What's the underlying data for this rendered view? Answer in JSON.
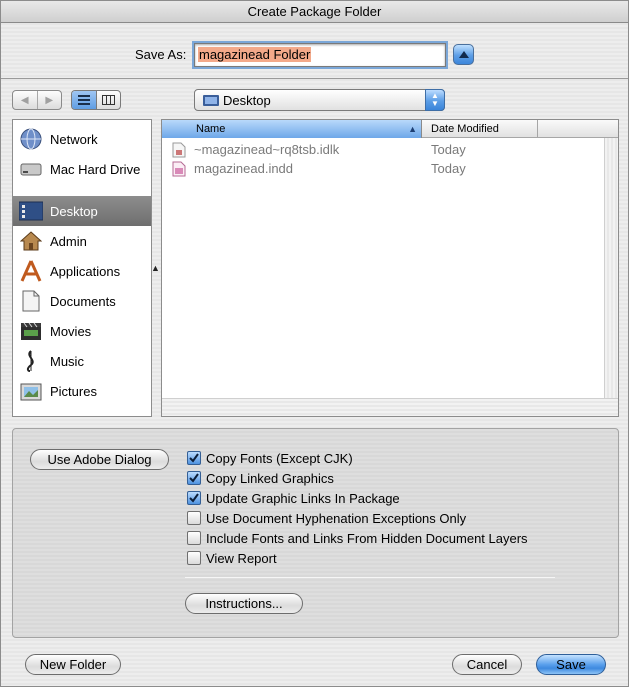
{
  "window": {
    "title": "Create Package Folder"
  },
  "save_as": {
    "label": "Save As:",
    "value": "magazinead Folder"
  },
  "location": {
    "current": "Desktop"
  },
  "sidebar": {
    "items": [
      {
        "label": "Network",
        "icon": "network-globe-icon"
      },
      {
        "label": "Mac Hard Drive",
        "icon": "hard-drive-icon"
      },
      {
        "label": "Desktop",
        "icon": "desktop-icon",
        "selected": true
      },
      {
        "label": "Admin",
        "icon": "home-icon"
      },
      {
        "label": "Applications",
        "icon": "applications-icon"
      },
      {
        "label": "Documents",
        "icon": "documents-icon"
      },
      {
        "label": "Movies",
        "icon": "movies-icon"
      },
      {
        "label": "Music",
        "icon": "music-icon"
      },
      {
        "label": "Pictures",
        "icon": "pictures-icon"
      }
    ]
  },
  "file_list": {
    "columns": {
      "name": "Name",
      "date": "Date Modified"
    },
    "rows": [
      {
        "name": "~magazinead~rq8tsb.idlk",
        "date": "Today"
      },
      {
        "name": "magazinead.indd",
        "date": "Today"
      }
    ]
  },
  "options": {
    "use_adobe_dialog": "Use Adobe Dialog",
    "checkboxes": [
      {
        "label": "Copy Fonts (Except CJK)",
        "checked": true
      },
      {
        "label": "Copy Linked Graphics",
        "checked": true
      },
      {
        "label": "Update Graphic Links In Package",
        "checked": true
      },
      {
        "label": "Use Document Hyphenation Exceptions Only",
        "checked": false
      },
      {
        "label": "Include Fonts and Links From Hidden Document Layers",
        "checked": false
      },
      {
        "label": "View Report",
        "checked": false
      }
    ],
    "instructions": "Instructions..."
  },
  "footer": {
    "new_folder": "New Folder",
    "cancel": "Cancel",
    "save": "Save"
  },
  "colors": {
    "accent": "#5aa0ec",
    "selection": "#f3a98a",
    "sidebar_selected": "#7b7b7b"
  }
}
